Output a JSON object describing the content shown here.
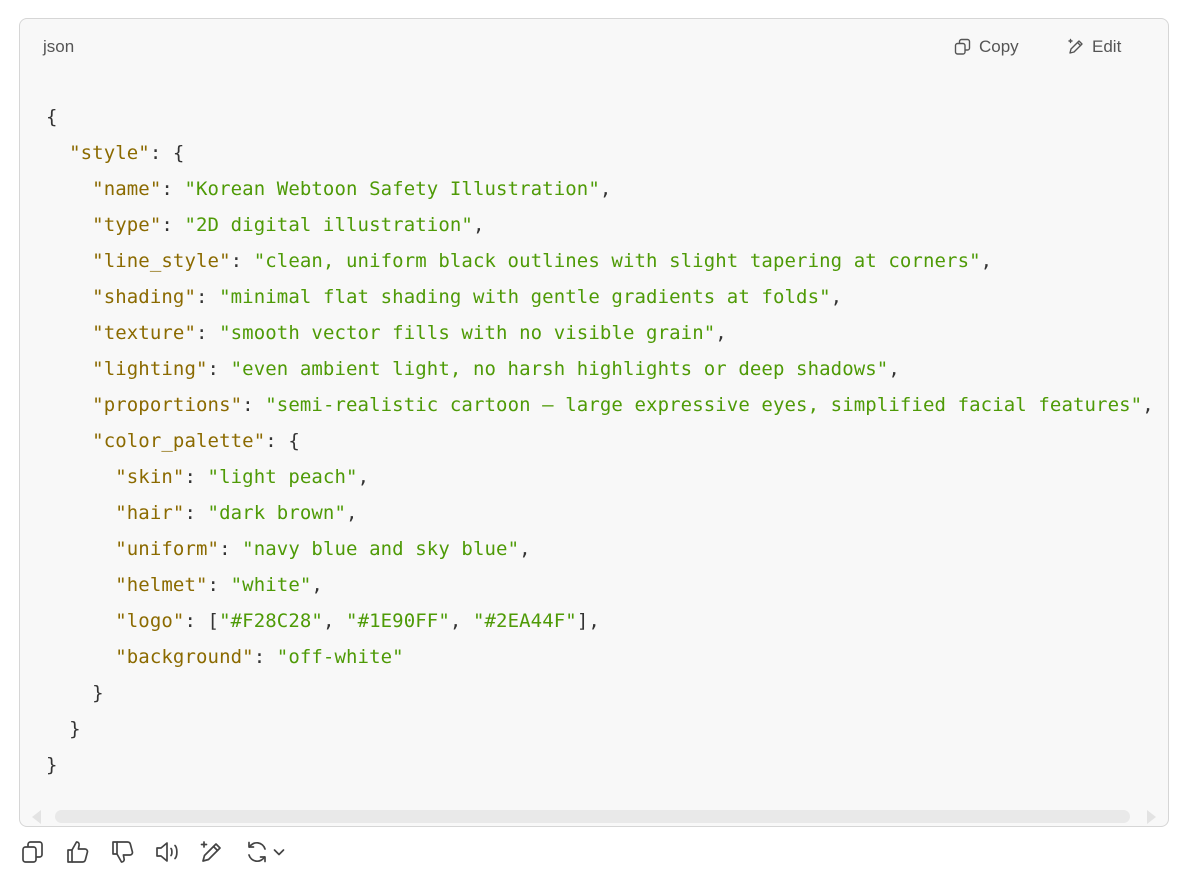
{
  "code_block": {
    "language": "json",
    "copy_label": "Copy",
    "edit_label": "Edit",
    "lines": [
      [
        {
          "t": "p",
          "v": "{"
        }
      ],
      [
        {
          "t": "p",
          "v": "  "
        },
        {
          "t": "k",
          "v": "\"style\""
        },
        {
          "t": "p",
          "v": ": {"
        }
      ],
      [
        {
          "t": "p",
          "v": "    "
        },
        {
          "t": "k",
          "v": "\"name\""
        },
        {
          "t": "p",
          "v": ": "
        },
        {
          "t": "s",
          "v": "\"Korean Webtoon Safety Illustration\""
        },
        {
          "t": "p",
          "v": ","
        }
      ],
      [
        {
          "t": "p",
          "v": "    "
        },
        {
          "t": "k",
          "v": "\"type\""
        },
        {
          "t": "p",
          "v": ": "
        },
        {
          "t": "s",
          "v": "\"2D digital illustration\""
        },
        {
          "t": "p",
          "v": ","
        }
      ],
      [
        {
          "t": "p",
          "v": "    "
        },
        {
          "t": "k",
          "v": "\"line_style\""
        },
        {
          "t": "p",
          "v": ": "
        },
        {
          "t": "s",
          "v": "\"clean, uniform black outlines with slight tapering at corners\""
        },
        {
          "t": "p",
          "v": ","
        }
      ],
      [
        {
          "t": "p",
          "v": "    "
        },
        {
          "t": "k",
          "v": "\"shading\""
        },
        {
          "t": "p",
          "v": ": "
        },
        {
          "t": "s",
          "v": "\"minimal flat shading with gentle gradients at folds\""
        },
        {
          "t": "p",
          "v": ","
        }
      ],
      [
        {
          "t": "p",
          "v": "    "
        },
        {
          "t": "k",
          "v": "\"texture\""
        },
        {
          "t": "p",
          "v": ": "
        },
        {
          "t": "s",
          "v": "\"smooth vector fills with no visible grain\""
        },
        {
          "t": "p",
          "v": ","
        }
      ],
      [
        {
          "t": "p",
          "v": "    "
        },
        {
          "t": "k",
          "v": "\"lighting\""
        },
        {
          "t": "p",
          "v": ": "
        },
        {
          "t": "s",
          "v": "\"even ambient light, no harsh highlights or deep shadows\""
        },
        {
          "t": "p",
          "v": ","
        }
      ],
      [
        {
          "t": "p",
          "v": "    "
        },
        {
          "t": "k",
          "v": "\"proportions\""
        },
        {
          "t": "p",
          "v": ": "
        },
        {
          "t": "s",
          "v": "\"semi-realistic cartoon — large expressive eyes, simplified facial features\""
        },
        {
          "t": "p",
          "v": ","
        }
      ],
      [
        {
          "t": "p",
          "v": "    "
        },
        {
          "t": "k",
          "v": "\"color_palette\""
        },
        {
          "t": "p",
          "v": ": {"
        }
      ],
      [
        {
          "t": "p",
          "v": "      "
        },
        {
          "t": "k",
          "v": "\"skin\""
        },
        {
          "t": "p",
          "v": ": "
        },
        {
          "t": "s",
          "v": "\"light peach\""
        },
        {
          "t": "p",
          "v": ","
        }
      ],
      [
        {
          "t": "p",
          "v": "      "
        },
        {
          "t": "k",
          "v": "\"hair\""
        },
        {
          "t": "p",
          "v": ": "
        },
        {
          "t": "s",
          "v": "\"dark brown\""
        },
        {
          "t": "p",
          "v": ","
        }
      ],
      [
        {
          "t": "p",
          "v": "      "
        },
        {
          "t": "k",
          "v": "\"uniform\""
        },
        {
          "t": "p",
          "v": ": "
        },
        {
          "t": "s",
          "v": "\"navy blue and sky blue\""
        },
        {
          "t": "p",
          "v": ","
        }
      ],
      [
        {
          "t": "p",
          "v": "      "
        },
        {
          "t": "k",
          "v": "\"helmet\""
        },
        {
          "t": "p",
          "v": ": "
        },
        {
          "t": "s",
          "v": "\"white\""
        },
        {
          "t": "p",
          "v": ","
        }
      ],
      [
        {
          "t": "p",
          "v": "      "
        },
        {
          "t": "k",
          "v": "\"logo\""
        },
        {
          "t": "p",
          "v": ": ["
        },
        {
          "t": "s",
          "v": "\"#F28C28\""
        },
        {
          "t": "p",
          "v": ", "
        },
        {
          "t": "s",
          "v": "\"#1E90FF\""
        },
        {
          "t": "p",
          "v": ", "
        },
        {
          "t": "s",
          "v": "\"#2EA44F\""
        },
        {
          "t": "p",
          "v": "],"
        }
      ],
      [
        {
          "t": "p",
          "v": "      "
        },
        {
          "t": "k",
          "v": "\"background\""
        },
        {
          "t": "p",
          "v": ": "
        },
        {
          "t": "s",
          "v": "\"off-white\""
        }
      ],
      [
        {
          "t": "p",
          "v": "    }"
        }
      ],
      [
        {
          "t": "p",
          "v": "  }"
        }
      ],
      [
        {
          "t": "p",
          "v": "}"
        }
      ]
    ]
  },
  "colors": {
    "key": "#8b6a00",
    "string": "#4e9a06",
    "punctuation": "#333333",
    "card_background": "#f8f8f8",
    "card_border": "#d6d6d6",
    "icon": "#555555"
  },
  "action_bar": {
    "icons": [
      "copy-icon",
      "thumbs-up-icon",
      "thumbs-down-icon",
      "read-aloud-icon",
      "edit-icon",
      "regenerate-icon",
      "chevron-down-icon"
    ]
  }
}
